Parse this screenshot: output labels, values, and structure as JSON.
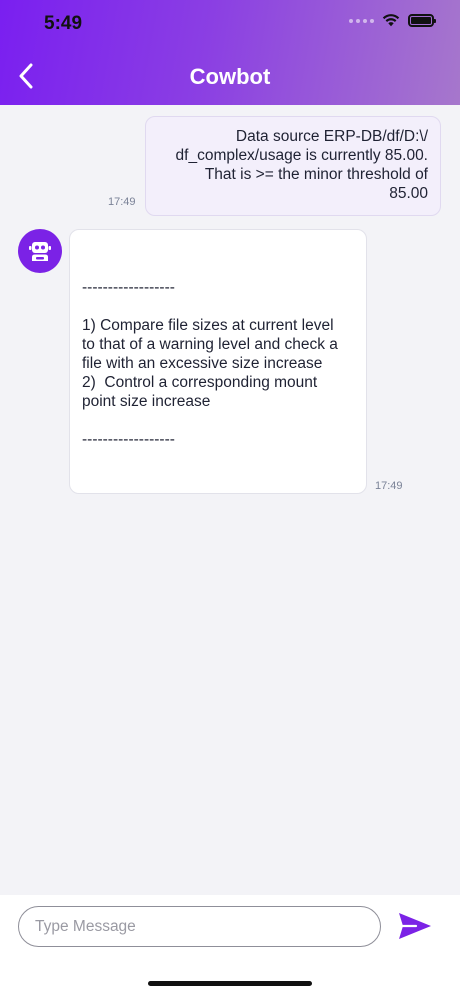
{
  "status_bar": {
    "time": "5:49"
  },
  "header": {
    "title": "Cowbot"
  },
  "messages": {
    "user": {
      "lines": [
        "Data source ERP-DB/df/D:\\/",
        "df_complex/usage is currently 85.00.",
        "That is >= the minor threshold of",
        "85.00"
      ],
      "timestamp": "17:49"
    },
    "bot": {
      "lines": [
        "------------------",
        "",
        "1) Compare file sizes at current level",
        "to that of a warning level and check a",
        "file with an excessive size increase",
        "2)  Control a corresponding mount",
        "point size increase",
        "",
        "------------------"
      ],
      "timestamp": "17:49"
    }
  },
  "composer": {
    "placeholder": "Type Message",
    "value": ""
  },
  "colors": {
    "accent": "#7b22e6",
    "header_start": "#7a1ff0",
    "header_end": "#a677cc",
    "background": "#f3f3f7"
  },
  "icons": {
    "back": "chevron-left-icon",
    "bot_avatar": "robot-icon",
    "send": "send-icon",
    "wifi": "wifi-icon",
    "battery": "battery-icon",
    "signal": "signal-icon"
  }
}
